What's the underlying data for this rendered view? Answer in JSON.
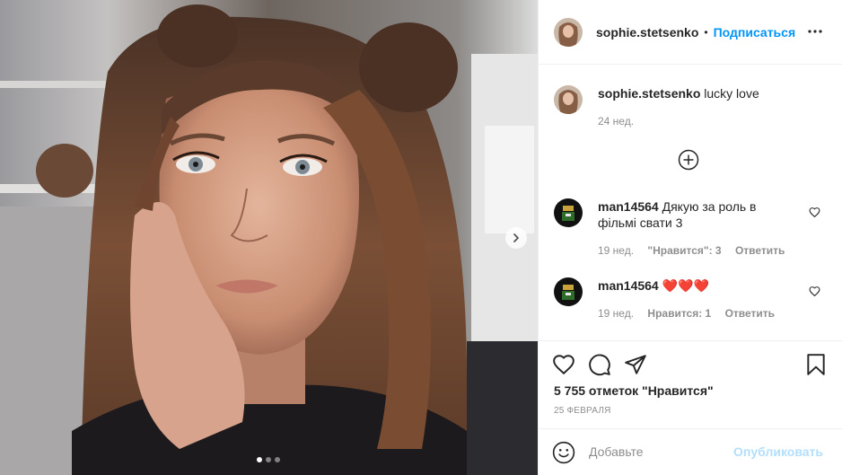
{
  "post": {
    "author": "sophie.stetsenko",
    "follow_label": "Подписаться",
    "bullet": "•",
    "more_icon": "more-horizontal-icon",
    "carousel": {
      "slide_count": 3,
      "active_slide": 1,
      "next_icon": "chevron-right-icon"
    }
  },
  "caption": {
    "username": "sophie.stetsenko",
    "text": "lucky love",
    "time": "24 нед."
  },
  "load_more_icon": "plus-circle-icon",
  "comments": [
    {
      "username": "man14564",
      "text": "Дякую за роль в фільмі свати 3",
      "time": "19 нед.",
      "likes": "\"Нравится\": 3",
      "reply": "Ответить"
    },
    {
      "username": "man14564",
      "text": "❤️❤️❤️",
      "time": "19 нед.",
      "likes": "Нравится: 1",
      "reply": "Ответить"
    }
  ],
  "actions": {
    "icons": [
      "heart-icon",
      "comment-icon",
      "share-icon",
      "bookmark-icon"
    ],
    "likes_text": "5 755 отметок \"Нравится\"",
    "date": "25 ФЕВРАЛЯ"
  },
  "add_comment": {
    "placeholder": "Добавьте",
    "publish_label": "Опубликовать",
    "emoji_icon": "emoji-icon"
  },
  "colors": {
    "accent": "#0095f6",
    "publish_disabled": "#b2dffc",
    "muted": "#8e8e8e",
    "heart_red": "#e0245e"
  }
}
